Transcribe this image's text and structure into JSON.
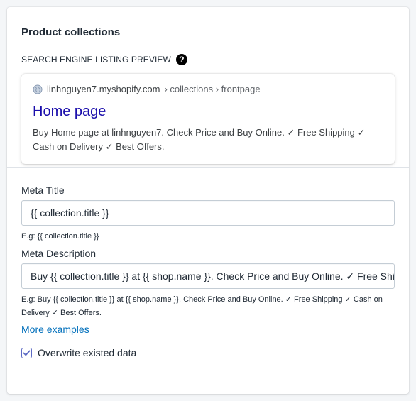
{
  "card": {
    "title": "Product collections"
  },
  "seo": {
    "heading": "SEARCH ENGINE LISTING PREVIEW",
    "help_symbol": "?",
    "domain": "linhnguyen7.myshopify.com",
    "path": " › collections › frontpage",
    "title": "Home page",
    "description": "Buy Home page at linhnguyen7. Check Price and Buy Online. ✓ Free Shipping ✓ Cash on Delivery ✓ Best Offers."
  },
  "meta_title": {
    "label": "Meta Title",
    "value": "{{ collection.title }}",
    "hint": "E.g: {{ collection.title }}"
  },
  "meta_description": {
    "label": "Meta Description",
    "value": "Buy {{ collection.title }} at {{ shop.name }}. Check Price and Buy Online. ✓ Free Shipping ✓ Cash on Delivery ✓ Best Offers.",
    "hint": "E.g: Buy {{ collection.title }} at {{ shop.name }}. Check Price and Buy Online. ✓ Free Shipping ✓ Cash on Delivery ✓ Best Offers.",
    "more_link": "More examples"
  },
  "overwrite": {
    "label": "Overwrite existed data",
    "checked": true
  },
  "colors": {
    "link": "#006fbb",
    "serp_title": "#1a0dab",
    "checkbox": "#5c6ac4"
  }
}
